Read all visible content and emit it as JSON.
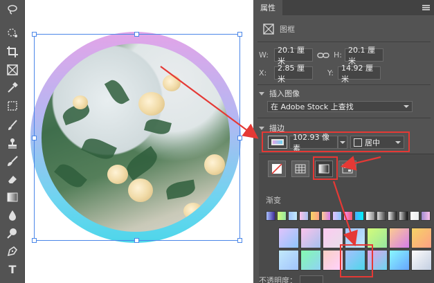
{
  "toolbar": {
    "tools": [
      "lasso-icon",
      "quick-select-icon",
      "crop-icon",
      "frame-icon",
      "eyedropper-icon",
      "healing-icon",
      "brush-icon",
      "stamp-icon",
      "history-brush-icon",
      "eraser-icon",
      "gradient-icon",
      "blur-icon",
      "dodge-icon",
      "pen-icon",
      "type-icon"
    ],
    "type_glyph": "T"
  },
  "panel": {
    "tab_label": "属性",
    "object_type": "图框",
    "transform": {
      "w_label": "W:",
      "w_value": "20.1 厘米",
      "h_label": "H:",
      "h_value": "20.1 厘米",
      "x_label": "X:",
      "x_value": "2.85 厘米",
      "y_label": "Y:",
      "y_value": "14.92 厘米"
    },
    "insert_image": {
      "title": "插入图像",
      "select_value": "在 Adobe Stock 上查找"
    },
    "stroke": {
      "title": "描边",
      "width_value": "102.93 像素",
      "align_value": "居中"
    },
    "gradient": {
      "title": "渐变",
      "opacity_label": "不透明度："
    }
  },
  "colors": {
    "panel_bg": "#535353",
    "selection": "#4a86e8",
    "annotation_red": "#e53935"
  }
}
